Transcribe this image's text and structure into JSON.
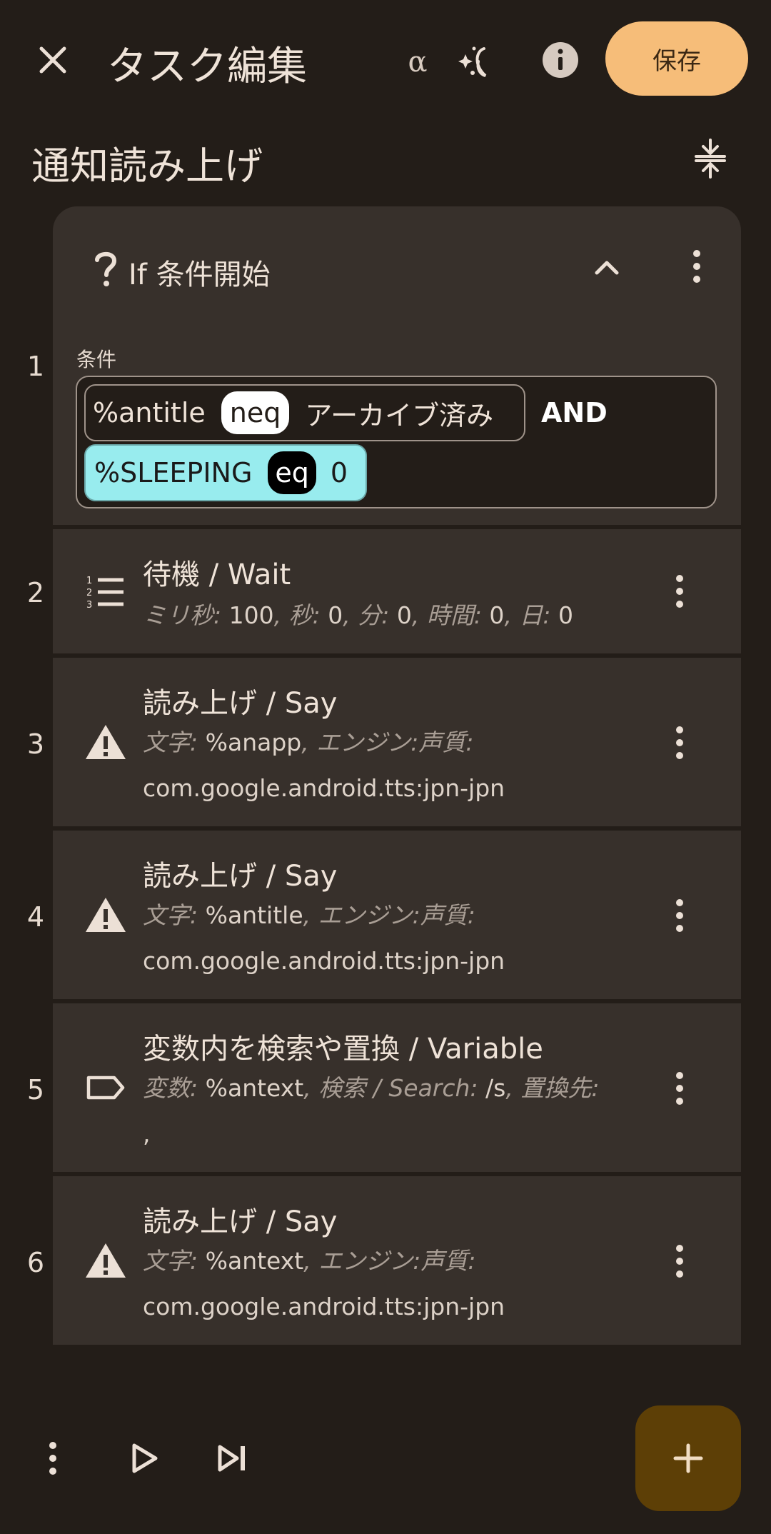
{
  "header": {
    "title": "タスク編集",
    "alpha_label": "α",
    "save_label": "保存"
  },
  "task": {
    "name": "通知読み上げ"
  },
  "actions": [
    {
      "number": "1",
      "title": "If 条件開始",
      "condition_label": "条件",
      "conditions": [
        {
          "variable": "%antitle",
          "operator": "neq",
          "value": "アーカイブ済み"
        },
        {
          "variable": "%SLEEPING",
          "operator": "eq",
          "value": "0"
        }
      ],
      "joiner": "AND"
    },
    {
      "number": "2",
      "title": "待機 / Wait",
      "desc": [
        {
          "k": "ミリ秒:",
          "v": " 100"
        },
        {
          "s": ", "
        },
        {
          "k": "秒:",
          "v": " 0"
        },
        {
          "s": ", "
        },
        {
          "k": "分:",
          "v": " 0"
        },
        {
          "s": ", "
        },
        {
          "k": "時間:",
          "v": " 0"
        },
        {
          "s": ", "
        },
        {
          "k": "日:",
          "v": " 0"
        }
      ]
    },
    {
      "number": "3",
      "title": "読み上げ / Say",
      "desc": [
        {
          "k": "文字:",
          "v": " %anapp"
        },
        {
          "s": ", "
        },
        {
          "k": "エンジン:声質:",
          "v": " com.google.android.tts:jpn-jpn"
        }
      ]
    },
    {
      "number": "4",
      "title": "読み上げ / Say",
      "desc": [
        {
          "k": "文字:",
          "v": " %antitle"
        },
        {
          "s": ", "
        },
        {
          "k": "エンジン:声質:",
          "v": " com.google.android.tts:jpn-jpn"
        }
      ]
    },
    {
      "number": "5",
      "title": "変数内を検索や置換 / Variable",
      "desc": [
        {
          "k": "変数:",
          "v": " %antext"
        },
        {
          "s": ", "
        },
        {
          "k": "検索 / Search:",
          "v": " /s"
        },
        {
          "s": ", "
        },
        {
          "k": "置換先:",
          "v": " ,"
        }
      ]
    },
    {
      "number": "6",
      "title": "読み上げ / Say",
      "desc": [
        {
          "k": "文字:",
          "v": " %antext"
        },
        {
          "s": ", "
        },
        {
          "k": "エンジン:声質:",
          "v": " com.google.android.tts:jpn-jpn"
        }
      ]
    }
  ],
  "icons": {
    "close": "close-icon",
    "magic": "magic-edit-icon",
    "info": "info-icon",
    "collapse_all": "collapse-all-icon",
    "if": "question-mark-icon",
    "wait": "numbered-list-icon",
    "say": "warning-icon",
    "variable": "label-tag-icon",
    "more": "more-vert-icon",
    "play": "play-icon",
    "step": "skip-next-icon",
    "add": "add-icon"
  },
  "colors": {
    "background": "#231d18",
    "card": "#37302b",
    "save_button": "#f6bd79",
    "fab": "#5d3f06",
    "condition_highlight": "#98ecee"
  }
}
